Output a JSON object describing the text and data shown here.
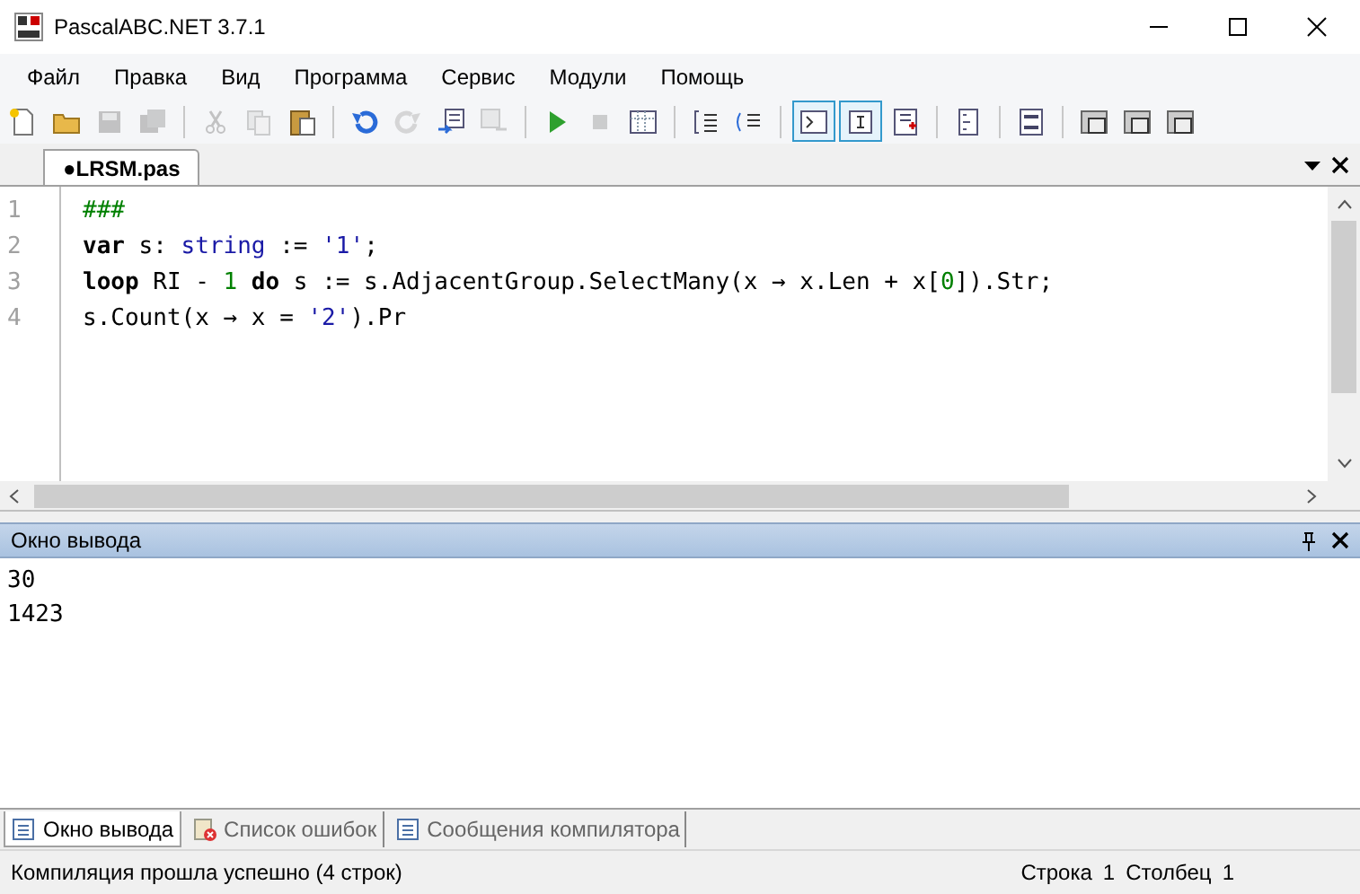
{
  "window": {
    "title": "PascalABC.NET 3.7.1"
  },
  "menu": [
    "Файл",
    "Правка",
    "Вид",
    "Программа",
    "Сервис",
    "Модули",
    "Помощь"
  ],
  "toolbar": [
    {
      "kind": "new",
      "disabled": false,
      "selected": false
    },
    {
      "kind": "open",
      "disabled": false,
      "selected": false
    },
    {
      "kind": "save",
      "disabled": true,
      "selected": false
    },
    {
      "kind": "saveall",
      "disabled": true,
      "selected": false
    },
    {
      "kind": "sep"
    },
    {
      "kind": "cut",
      "disabled": true,
      "selected": false
    },
    {
      "kind": "copy",
      "disabled": true,
      "selected": false
    },
    {
      "kind": "paste",
      "disabled": false,
      "selected": false
    },
    {
      "kind": "sep"
    },
    {
      "kind": "undo",
      "disabled": false,
      "selected": false
    },
    {
      "kind": "redo",
      "disabled": true,
      "selected": false
    },
    {
      "kind": "outdent",
      "disabled": false,
      "selected": false
    },
    {
      "kind": "indent",
      "disabled": true,
      "selected": false
    },
    {
      "kind": "sep"
    },
    {
      "kind": "run",
      "disabled": false,
      "selected": false
    },
    {
      "kind": "stop",
      "disabled": true,
      "selected": false
    },
    {
      "kind": "step",
      "disabled": false,
      "selected": false
    },
    {
      "kind": "sep"
    },
    {
      "kind": "comment",
      "disabled": false,
      "selected": false
    },
    {
      "kind": "uncomment",
      "disabled": false,
      "selected": false
    },
    {
      "kind": "sep"
    },
    {
      "kind": "console",
      "disabled": false,
      "selected": true
    },
    {
      "kind": "input",
      "disabled": false,
      "selected": true
    },
    {
      "kind": "spell",
      "disabled": false,
      "selected": false
    },
    {
      "kind": "sep"
    },
    {
      "kind": "list",
      "disabled": false,
      "selected": false
    },
    {
      "kind": "sep"
    },
    {
      "kind": "code",
      "disabled": false,
      "selected": false
    },
    {
      "kind": "sep"
    },
    {
      "kind": "doc",
      "disabled": false,
      "selected": false
    },
    {
      "kind": "doc",
      "disabled": false,
      "selected": false
    },
    {
      "kind": "doc",
      "disabled": false,
      "selected": false
    }
  ],
  "editor_tabs": [
    {
      "label": "●LRSM.pas",
      "selected": true
    }
  ],
  "code": [
    {
      "number": "1",
      "tokens": [
        {
          "kind": "comment",
          "text": "###"
        }
      ]
    },
    {
      "number": "2",
      "tokens": [
        {
          "kind": "kw",
          "text": "var"
        },
        {
          "kind": "plain",
          "text": " s: "
        },
        {
          "kind": "type",
          "text": "string"
        },
        {
          "kind": "plain",
          "text": " := "
        },
        {
          "kind": "str",
          "text": "'1'"
        },
        {
          "kind": "plain",
          "text": ";"
        }
      ]
    },
    {
      "number": "3",
      "tokens": [
        {
          "kind": "kw",
          "text": "loop"
        },
        {
          "kind": "plain",
          "text": " RI - "
        },
        {
          "kind": "num",
          "text": "1"
        },
        {
          "kind": "kw",
          "text": " do"
        },
        {
          "kind": "plain",
          "text": " s := s.AdjacentGroup.SelectMany(x → x.Len + x["
        },
        {
          "kind": "num",
          "text": "0"
        },
        {
          "kind": "plain",
          "text": "]).Str;"
        }
      ]
    },
    {
      "number": "4",
      "tokens": [
        {
          "kind": "plain",
          "text": "s.Count(x → x = "
        },
        {
          "kind": "str",
          "text": "'2'"
        },
        {
          "kind": "plain",
          "text": ").Pr"
        }
      ]
    }
  ],
  "output_panel": {
    "title": "Окно вывода",
    "lines": [
      "30",
      "1423"
    ]
  },
  "bottom_tabs": [
    {
      "label": "Окно вывода",
      "selected": true,
      "kind": "list"
    },
    {
      "label": "Список ошибок",
      "selected": false,
      "kind": "errors"
    },
    {
      "label": "Сообщения компилятора",
      "selected": false,
      "kind": "list"
    }
  ],
  "status_bar": {
    "message": "Компиляция прошла успешно (4 строк)",
    "row_label": "Строка",
    "row": "1",
    "col_label": "Столбец",
    "col": "1"
  }
}
